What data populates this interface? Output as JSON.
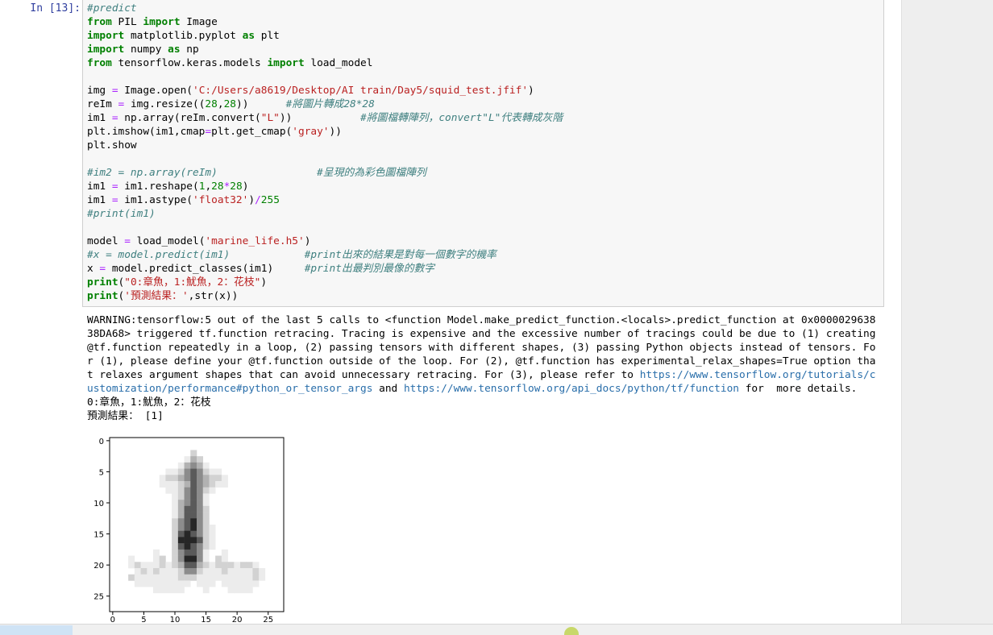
{
  "cell": {
    "prompt": "In [13]:",
    "code_lines": [
      [
        {
          "t": "#predict",
          "c": "cm"
        }
      ],
      [
        {
          "t": "from",
          "c": "kw"
        },
        {
          "t": " PIL "
        },
        {
          "t": "import",
          "c": "kw"
        },
        {
          "t": " Image"
        }
      ],
      [
        {
          "t": "import",
          "c": "kw"
        },
        {
          "t": " matplotlib.pyplot "
        },
        {
          "t": "as",
          "c": "kw"
        },
        {
          "t": " plt"
        }
      ],
      [
        {
          "t": "import",
          "c": "kw"
        },
        {
          "t": " numpy "
        },
        {
          "t": "as",
          "c": "kw"
        },
        {
          "t": " np"
        }
      ],
      [
        {
          "t": "from",
          "c": "kw"
        },
        {
          "t": " tensorflow.keras.models "
        },
        {
          "t": "import",
          "c": "kw"
        },
        {
          "t": " load_model"
        }
      ],
      [],
      [
        {
          "t": "img "
        },
        {
          "t": "=",
          "c": "op"
        },
        {
          "t": " Image.open("
        },
        {
          "t": "'C:/Users/a8619/Desktop/AI train/Day5/squid_test.jfif'",
          "c": "st"
        },
        {
          "t": ")"
        }
      ],
      [
        {
          "t": "reIm "
        },
        {
          "t": "=",
          "c": "op"
        },
        {
          "t": " img.resize(("
        },
        {
          "t": "28",
          "c": "nm"
        },
        {
          "t": ","
        },
        {
          "t": "28",
          "c": "nm"
        },
        {
          "t": "))      "
        },
        {
          "t": "#將圖片轉成28*28",
          "c": "cm"
        }
      ],
      [
        {
          "t": "im1 "
        },
        {
          "t": "=",
          "c": "op"
        },
        {
          "t": " np.array(reIm.convert("
        },
        {
          "t": "\"L\"",
          "c": "st"
        },
        {
          "t": "))           "
        },
        {
          "t": "#將圖檔轉陣列，convert\"L\"代表轉成灰階",
          "c": "cm"
        }
      ],
      [
        {
          "t": "plt.imshow(im1,cmap"
        },
        {
          "t": "=",
          "c": "op"
        },
        {
          "t": "plt.get_cmap("
        },
        {
          "t": "'gray'",
          "c": "st"
        },
        {
          "t": "))"
        }
      ],
      [
        {
          "t": "plt.show"
        }
      ],
      [],
      [
        {
          "t": "#im2 = np.array(reIm)                #呈現的為彩色圖檔陣列",
          "c": "cm"
        }
      ],
      [
        {
          "t": "im1 "
        },
        {
          "t": "=",
          "c": "op"
        },
        {
          "t": " im1.reshape("
        },
        {
          "t": "1",
          "c": "nm"
        },
        {
          "t": ","
        },
        {
          "t": "28",
          "c": "nm"
        },
        {
          "t": "*",
          "c": "op"
        },
        {
          "t": "28",
          "c": "nm"
        },
        {
          "t": ")"
        }
      ],
      [
        {
          "t": "im1 "
        },
        {
          "t": "=",
          "c": "op"
        },
        {
          "t": " im1.astype("
        },
        {
          "t": "'float32'",
          "c": "st"
        },
        {
          "t": ")"
        },
        {
          "t": "/",
          "c": "op"
        },
        {
          "t": "255",
          "c": "nm"
        }
      ],
      [
        {
          "t": "#print(im1)",
          "c": "cm"
        }
      ],
      [],
      [
        {
          "t": "model "
        },
        {
          "t": "=",
          "c": "op"
        },
        {
          "t": " load_model("
        },
        {
          "t": "'marine_life.h5'",
          "c": "st"
        },
        {
          "t": ")"
        }
      ],
      [
        {
          "t": "#x = model.predict(im1)            #print出來的結果是對每一個數字的機率",
          "c": "cm"
        }
      ],
      [
        {
          "t": "x "
        },
        {
          "t": "=",
          "c": "op"
        },
        {
          "t": " model.predict_classes(im1)     "
        },
        {
          "t": "#print出最判別最像的數字",
          "c": "cm"
        }
      ],
      [
        {
          "t": "print",
          "c": "kw"
        },
        {
          "t": "("
        },
        {
          "t": "\"0:章魚，1:魷魚，2：花枝\"",
          "c": "st"
        },
        {
          "t": ")"
        }
      ],
      [
        {
          "t": "print",
          "c": "kw"
        },
        {
          "t": "("
        },
        {
          "t": "'預測結果：'",
          "c": "st"
        },
        {
          "t": ",str(x))"
        }
      ]
    ],
    "output_lines": [
      [
        {
          "t": "WARNING:tensorflow:5 out of the last 5 calls to <function Model.make_predict_function.<locals>.predict_function at 0x0000029638"
        }
      ],
      [
        {
          "t": "38DA68> triggered tf.function retracing. Tracing is expensive and the excessive number of tracings could be due to (1) creating"
        }
      ],
      [
        {
          "t": "@tf.function repeatedly in a loop, (2) passing tensors with different shapes, (3) passing Python objects instead of tensors. Fo"
        }
      ],
      [
        {
          "t": "r (1), please define your @tf.function outside of the loop. For (2), @tf.function has experimental_relax_shapes=True option tha"
        }
      ],
      [
        {
          "t": "t relaxes argument shapes that can avoid unnecessary retracing. For (3), please refer to "
        },
        {
          "t": "https://www.tensorflow.org/tutorials/c",
          "link": true
        }
      ],
      [
        {
          "t": "ustomization/performance#python_or_tensor_args",
          "link": true
        },
        {
          "t": " and "
        },
        {
          "t": "https://www.tensorflow.org/api_docs/python/tf/function",
          "link": true
        },
        {
          "t": " for  more details."
        }
      ],
      [
        {
          "t": "0:章魚，1:魷魚，2：花枝"
        }
      ],
      [
        {
          "t": "預測結果： [1]"
        }
      ]
    ]
  },
  "chart_data": {
    "type": "heatmap",
    "cmap": "gray",
    "xticks": [
      0,
      5,
      10,
      15,
      20,
      25
    ],
    "yticks": [
      0,
      5,
      10,
      15,
      20,
      25
    ],
    "xlim": [
      -0.5,
      27.5
    ],
    "ylim": [
      27.5,
      -0.5
    ],
    "image_rows": [
      "0000000000000000000000000000",
      "0000000000000000000000000000",
      "0000000000000200000000000000",
      "0000000000001320000000000000",
      "0000000000013431000000000000",
      "0000000001124542110000000000",
      "0000000012234543221000000000",
      "0000000011123543211000000000",
      "0000000001124542100000000000",
      "0000000000124541000000000000",
      "0000000000134541000000000000",
      "0000000000135542000000000000",
      "0000000000135542000000000000",
      "0000000000245642000000000000",
      "0000000000245642100000000000",
      "0000000000256542100000000000",
      "0000000000266652100000000000",
      "0000000000256542100000000000",
      "0000000100245541001000000000",
      "0001000120246641021000000000",
      "0001211121235532122212210000",
      "0000121211124421112111121000",
      "0002111111122211111111121000",
      "0000111111111011101111110000",
      "0000000111110001000111100000",
      "0000000000000000000000000000",
      "0000000000000000000000000000",
      "0000000000000000000000000000"
    ]
  }
}
